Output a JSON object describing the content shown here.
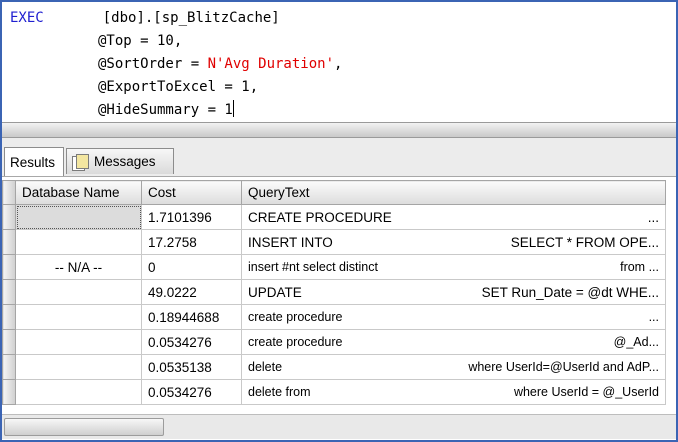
{
  "editor": {
    "lines": [
      {
        "keyword": "EXEC",
        "text": "[dbo].[sp_BlitzCache]"
      },
      {
        "param": "@Top = 10,"
      },
      {
        "param": "@SortOrder = ",
        "string": "N'Avg Duration'",
        "tail": ","
      },
      {
        "param": "@ExportToExcel = 1,"
      },
      {
        "param": "@HideSummary = 1"
      }
    ]
  },
  "tabs": {
    "results": "Results",
    "messages": "Messages"
  },
  "grid": {
    "columns": [
      "Database Name",
      "Cost",
      "QueryText"
    ],
    "rows": [
      {
        "db": "",
        "cost": "1.7101396",
        "q_left": "CREATE PROCEDURE",
        "q_right": "..."
      },
      {
        "db": "",
        "cost": "17.2758",
        "q_left": "INSERT INTO",
        "q_right": "SELECT * FROM OPE..."
      },
      {
        "db": "-- N/A --",
        "cost": "0",
        "q_left": "insert #nt select distinct",
        "q_right": "from ..."
      },
      {
        "db": "",
        "cost": "49.0222",
        "q_left": "UPDATE",
        "q_right": "SET Run_Date = @dt WHE..."
      },
      {
        "db": "",
        "cost": "0.18944688",
        "q_left": "create procedure",
        "q_right": "..."
      },
      {
        "db": "",
        "cost": "0.0534276",
        "q_left": "create procedure",
        "q_right": "@_Ad..."
      },
      {
        "db": "",
        "cost": "0.0535138",
        "q_left": "delete",
        "q_right": "where UserId=@UserId and AdP..."
      },
      {
        "db": "",
        "cost": "0.0534276",
        "q_left": "delete from",
        "q_right": "where UserId = @_UserId"
      }
    ]
  },
  "colors": {
    "keyword": "#1f1fd0",
    "string": "#e00000",
    "frame": "#3b64b4"
  }
}
